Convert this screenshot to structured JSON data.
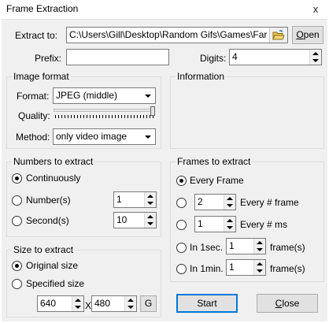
{
  "window": {
    "title": "Frame Extraction",
    "close_glyph": "x"
  },
  "extract": {
    "label": "Extract to:",
    "path": "C:\\Users\\Gill\\Desktop\\Random Gifs\\Games\\Far C",
    "open_label_prefix": "",
    "open_label_ul": "O",
    "open_label_rest": "pen",
    "folder_icon": "folder-open-icon"
  },
  "prefix": {
    "label": "Prefix:",
    "value": ""
  },
  "digits": {
    "label": "Digits:",
    "value": "4"
  },
  "image_format": {
    "title": "Image format",
    "format_label": "Format:",
    "format_value": "JPEG (middle)",
    "quality_label": "Quality:",
    "quality_level": 1.0,
    "method_label": "Method:",
    "method_value": "only video image"
  },
  "information": {
    "title": "Information"
  },
  "numbers": {
    "title": "Numbers to extract",
    "continuously": "Continuously",
    "numbers_label": "Number(s)",
    "numbers_value": "1",
    "seconds_label": "Second(s)",
    "seconds_value": "10",
    "selected": "continuously"
  },
  "size": {
    "title": "Size to extract",
    "original": "Original size",
    "specified": "Specified size",
    "width": "640",
    "x_label": "X",
    "height": "480",
    "g_label": "G",
    "selected": "original"
  },
  "frames": {
    "title": "Frames to extract",
    "every_frame": "Every Frame",
    "every_n_frame_value": "2",
    "every_n_frame_label": "Every # frame",
    "every_n_ms_value": "1",
    "every_n_ms_label": "Every # ms",
    "in_1sec_label": "In 1sec.",
    "in_1sec_value": "1",
    "in_1sec_unit": "frame(s)",
    "in_1min_label": "In 1min.",
    "in_1min_value": "1",
    "in_1min_unit": "frame(s)",
    "selected": "every_frame"
  },
  "buttons": {
    "start": "Start",
    "close_prefix": "",
    "close_ul": "C",
    "close_rest": "lose"
  }
}
